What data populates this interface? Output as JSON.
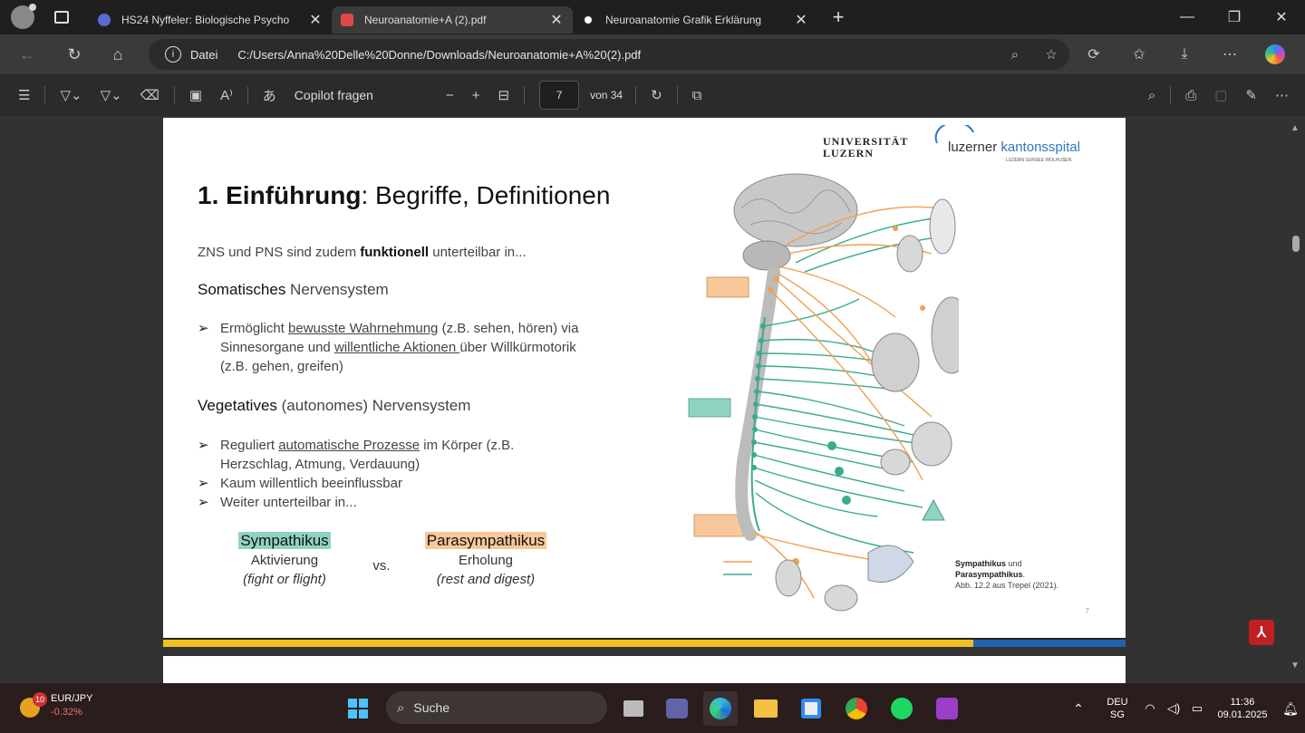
{
  "tabs": [
    {
      "title": "HS24 Nyffeler: Biologische Psycho",
      "favicon_color": "#5a6ad0",
      "active": false
    },
    {
      "title": "Neuroanatomie+A (2).pdf",
      "favicon_color": "#e04848",
      "active": true
    },
    {
      "title": "Neuroanatomie Grafik Erklärung",
      "favicon_color": "#ffffff",
      "active": false
    }
  ],
  "address": {
    "scheme_label": "Datei",
    "url": "C:/Users/Anna%20Delle%20Donne/Downloads/Neuroanatomie+A%20(2).pdf"
  },
  "pdf_toolbar": {
    "copilot_label": "Copilot fragen",
    "page_current": "7",
    "page_total_label": "von 34"
  },
  "slide": {
    "logo_uni_line1": "UNIVERSITÄT",
    "logo_uni_line2": "LUZERN",
    "logo_luks_a": "luzerner",
    "logo_luks_b": "kantonsspital",
    "logo_luks_sub": "LUZERN SURSEE WOLHUSEN",
    "title_bold": "1. Einführung",
    "title_rest": ": Begriffe, Definitionen",
    "intro_a": "ZNS und PNS sind zudem ",
    "intro_b": "funktionell",
    "intro_c": " unterteilbar in...",
    "somatic_bold": "Somatisches",
    "somatic_rest": " Nervensystem",
    "somatic_b1_a": "Ermöglicht ",
    "somatic_b1_u1": "bewusste Wahrnehmung",
    "somatic_b1_b": " (z.B. sehen, hören) via",
    "somatic_b1_c": "Sinnesorgane und ",
    "somatic_b1_u2": "willentliche Aktionen ",
    "somatic_b1_d": "über Willkürmotorik",
    "somatic_b1_e": "(z.B. gehen, greifen)",
    "veg_bold": "Vegetatives",
    "veg_rest": " (autonomes) Nervensystem",
    "veg_b1_a": "Reguliert ",
    "veg_b1_u": "automatische Prozesse",
    "veg_b1_b": " im Körper (z.B.",
    "veg_b1_c": "Herzschlag, Atmung, Verdauung)",
    "veg_b2": "Kaum willentlich beeinflussbar",
    "veg_b3": "Weiter unterteilbar in...",
    "sym_label": "Sympathikus",
    "sym_sub": "Aktivierung",
    "sym_sub2": "(fight or flight)",
    "vs_label": "vs.",
    "para_label": "Parasympathikus",
    "para_sub": "Erholung",
    "para_sub2": "(rest and digest)",
    "caption_b1": "Sympathikus",
    "caption_t1": " und",
    "caption_b2": "Parasympathikus",
    "caption_t2": ".",
    "caption_src": "Abb. 12.2 aus Trepel (2021).",
    "page_no": "7",
    "arrow": "➢",
    "colors": {
      "sympathikus": "#8fd3c3",
      "parasympathikus": "#f8c89a"
    }
  },
  "taskbar": {
    "ticker": "EUR/JPY",
    "ticker_change": "-0.32%",
    "ticker_badge": "10",
    "search_label": "Suche",
    "lang_line1": "DEU",
    "lang_line2": "SG",
    "time": "11:36",
    "date": "09.01.2025"
  }
}
